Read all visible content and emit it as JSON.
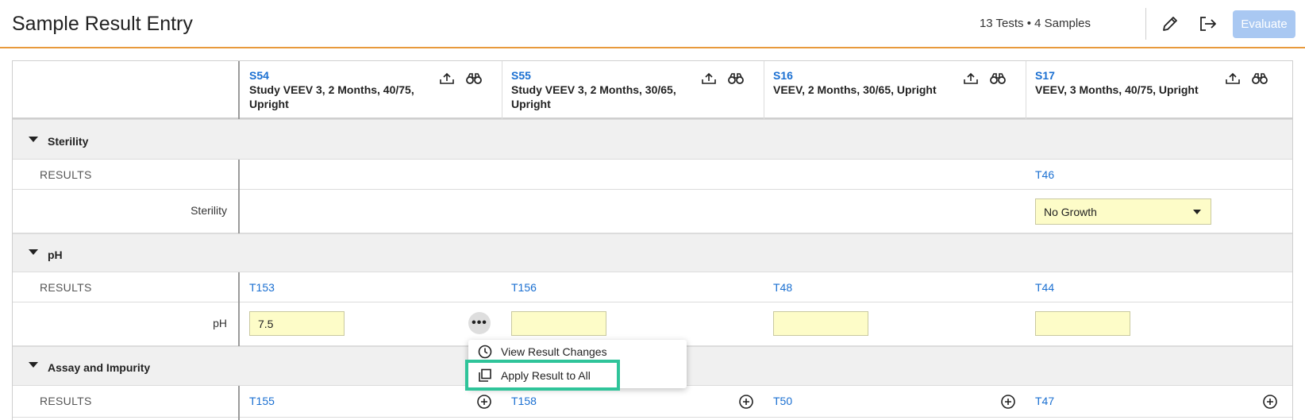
{
  "header": {
    "title": "Sample Result Entry",
    "summary": "13 Tests • 4 Samples",
    "edit_icon": "pencil-icon",
    "exit_icon": "sign-out-icon",
    "evaluate_label": "Evaluate",
    "evaluate_color": "#a9c8f2"
  },
  "samples": [
    {
      "id": "S54",
      "desc": "Study VEEV 3, 2 Months, 40/75, Upright"
    },
    {
      "id": "S55",
      "desc": "Study VEEV 3, 2 Months, 30/65, Upright"
    },
    {
      "id": "S16",
      "desc": "VEEV, 2 Months, 30/65, Upright"
    },
    {
      "id": "S17",
      "desc": "VEEV, 3 Months, 40/75, Upright"
    }
  ],
  "column_icons": [
    "upload-icon",
    "binoculars-icon"
  ],
  "sections": {
    "sterility": {
      "title": "Sterility",
      "results_label": "RESULTS",
      "tests": [
        "",
        "",
        "",
        "T46"
      ],
      "row_label": "Sterility",
      "select_value": "No Growth"
    },
    "ph": {
      "title": "pH",
      "results_label": "RESULTS",
      "tests": [
        "T153",
        "T156",
        "T48",
        "T44"
      ],
      "row_label": "pH",
      "values": [
        "7.5",
        "",
        "",
        ""
      ]
    },
    "assay": {
      "title": "Assay and Impurity",
      "results_label": "RESULTS",
      "tests": [
        "T155",
        "T158",
        "T50",
        "T47"
      ]
    }
  },
  "context_menu": {
    "items": [
      {
        "label": "View Result Changes",
        "icon": "history-icon"
      },
      {
        "label": "Apply Result to All",
        "icon": "copy-icon"
      }
    ],
    "highlight_color": "#2fc49a"
  },
  "colors": {
    "accent_underline": "#e89a3c",
    "link": "#1a6fd1",
    "input_bg": "#fdfcc8"
  }
}
